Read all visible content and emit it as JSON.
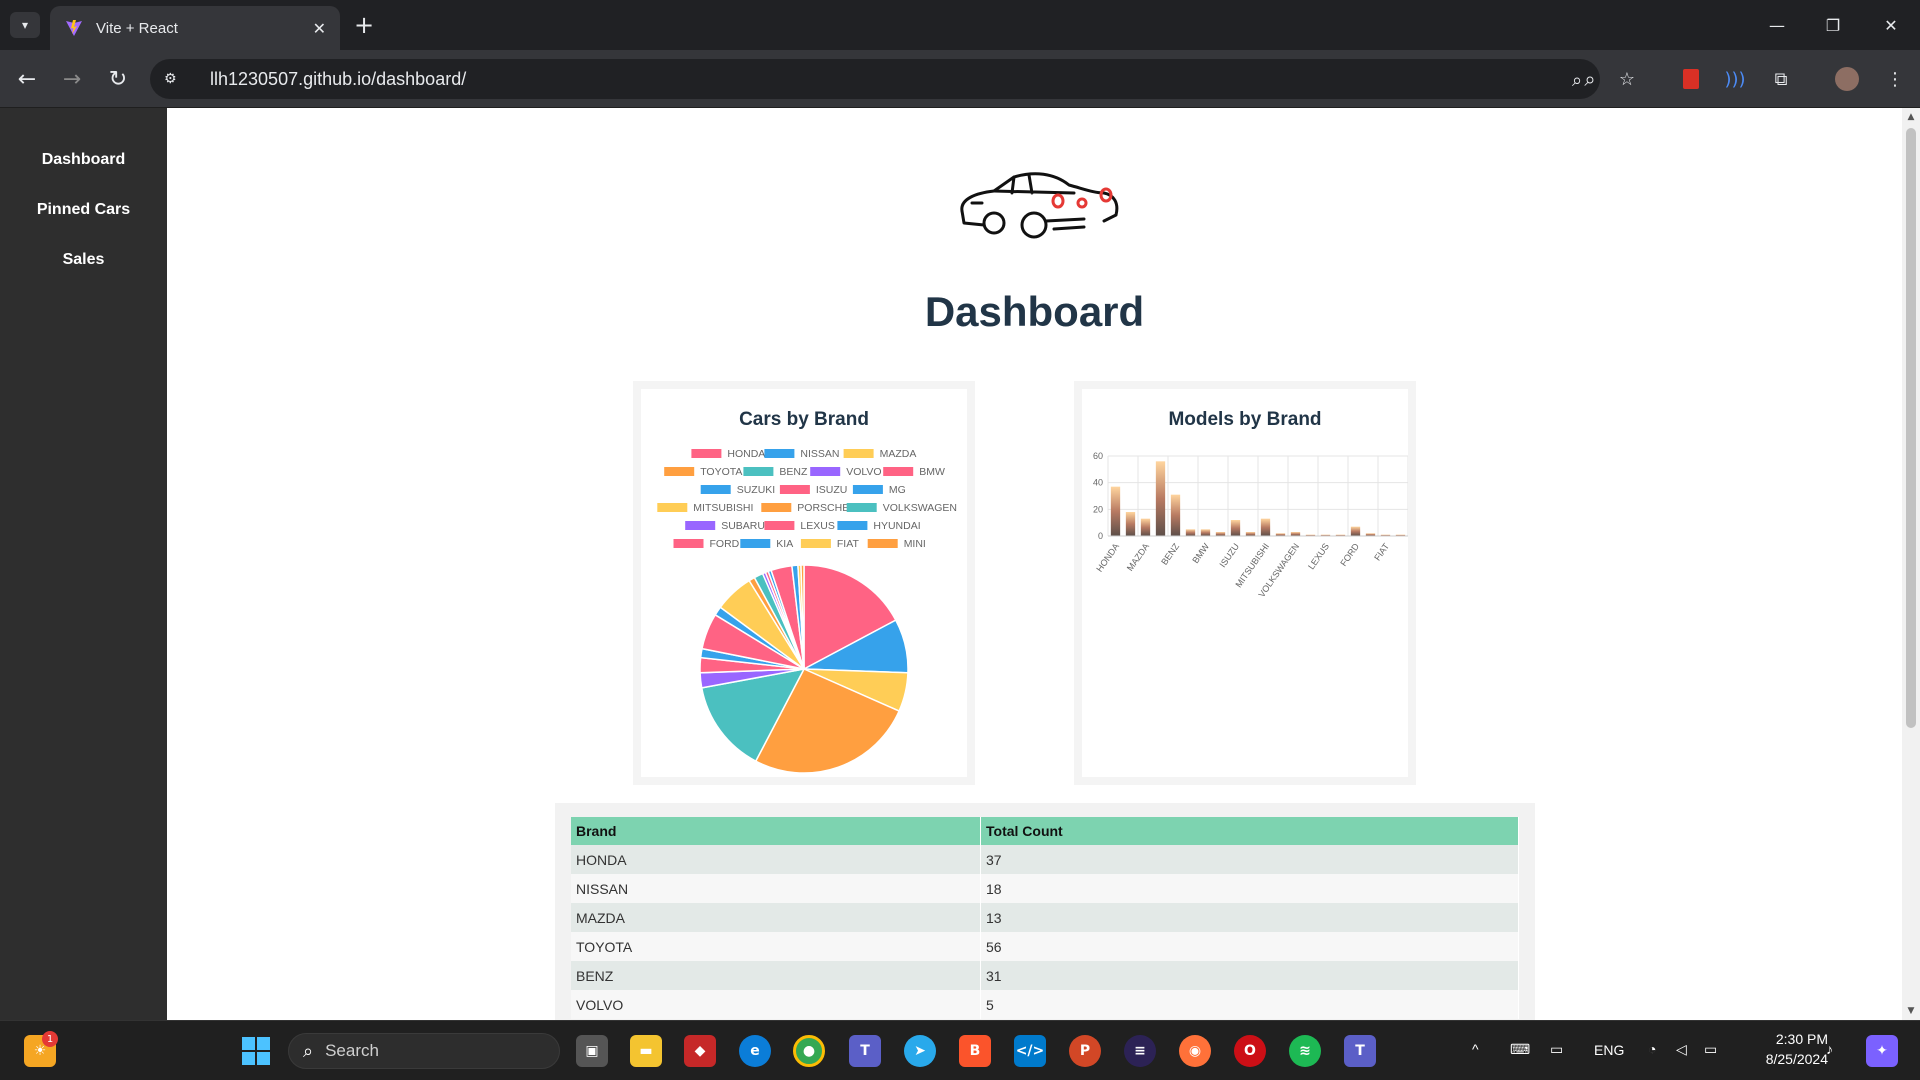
{
  "browser": {
    "tab_title": "Vite + React",
    "url": "llh1230507.github.io/dashboard/"
  },
  "sidebar": {
    "items": [
      {
        "label": "Dashboard"
      },
      {
        "label": "Pinned Cars"
      },
      {
        "label": "Sales"
      }
    ]
  },
  "main": {
    "title": "Dashboard"
  },
  "chart_data": [
    {
      "type": "pie",
      "title": "Cars by Brand",
      "legend_position": "top",
      "categories": [
        "HONDA",
        "NISSAN",
        "MAZDA",
        "TOYOTA",
        "BENZ",
        "VOLVO",
        "BMW",
        "SUZUKI",
        "ISUZU",
        "MG",
        "MITSUBISHI",
        "PORSCHE",
        "VOLKSWAGEN",
        "SUBARU",
        "LEXUS",
        "HYUNDAI",
        "FORD",
        "KIA",
        "FIAT",
        "MINI"
      ],
      "values": [
        37,
        18,
        13,
        56,
        31,
        5,
        5,
        3,
        12,
        3,
        13,
        2,
        3,
        1,
        1,
        1,
        7,
        2,
        1,
        1
      ],
      "colors": [
        "#ff6384",
        "#36a2eb",
        "#ffcd56",
        "#ff9f40",
        "#4bc0c0",
        "#9966ff",
        "#ff6384",
        "#36a2eb",
        "#ff6384",
        "#36a2eb",
        "#ffcd56",
        "#ff9f40",
        "#4bc0c0",
        "#9966ff",
        "#ff6384",
        "#36a2eb",
        "#ff6384",
        "#36a2eb",
        "#ffcd56",
        "#ff9f40"
      ]
    },
    {
      "type": "bar",
      "title": "Models by Brand",
      "categories": [
        "HONDA",
        "NISSAN",
        "MAZDA",
        "TOYOTA",
        "BENZ",
        "VOLVO",
        "BMW",
        "SUZUKI",
        "ISUZU",
        "MG",
        "MITSUBISHI",
        "PORSCHE",
        "VOLKSWAGEN",
        "SUBARU",
        "LEXUS",
        "HYUNDAI",
        "FORD",
        "KIA",
        "FIAT",
        "MINI"
      ],
      "values": [
        37,
        18,
        13,
        56,
        31,
        5,
        5,
        3,
        12,
        3,
        13,
        2,
        3,
        1,
        1,
        1,
        7,
        2,
        1,
        1
      ],
      "shown_tick_labels": [
        "HONDA",
        "MAZDA",
        "BENZ",
        "BMW",
        "ISUZU",
        "MITSUBISHI",
        "VOLKSWAGEN",
        "LEXUS",
        "FORD",
        "FIAT"
      ],
      "yticks": [
        "0",
        "20",
        "40",
        "60"
      ],
      "ylim": [
        0,
        60
      ],
      "grid": true
    }
  ],
  "table": {
    "headers": [
      "Brand",
      "Total Count"
    ],
    "rows": [
      [
        "HONDA",
        "37"
      ],
      [
        "NISSAN",
        "18"
      ],
      [
        "MAZDA",
        "13"
      ],
      [
        "TOYOTA",
        "56"
      ],
      [
        "BENZ",
        "31"
      ],
      [
        "VOLVO",
        "5"
      ]
    ]
  },
  "taskbar": {
    "search_placeholder": "Search",
    "notification_count": "1",
    "language": "ENG",
    "time": "2:30 PM",
    "date": "8/25/2024"
  }
}
